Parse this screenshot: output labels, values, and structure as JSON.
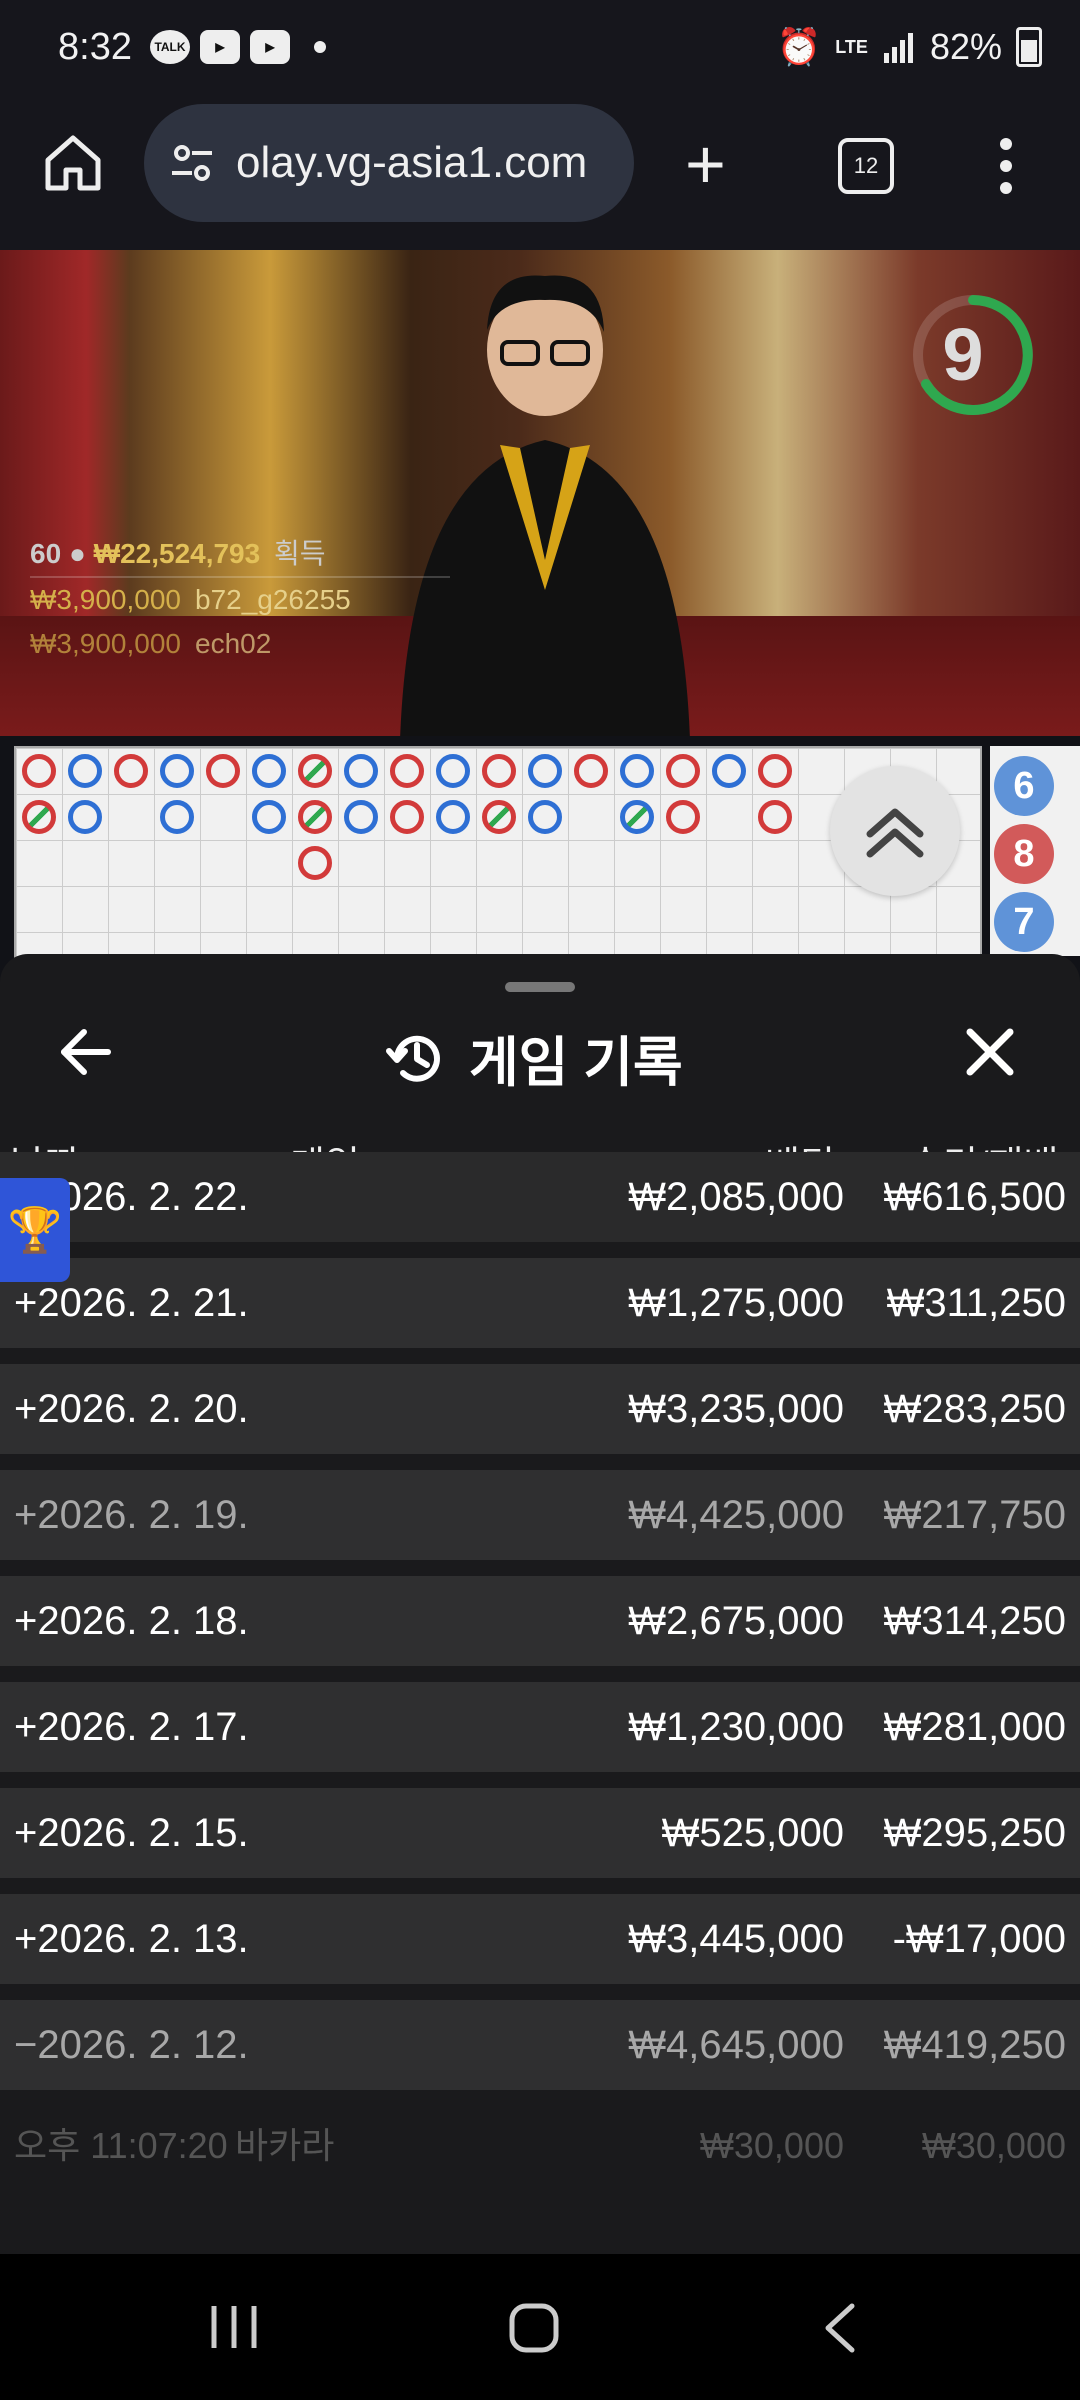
{
  "status": {
    "time": "8:32",
    "network": "LTE",
    "battery": "82%",
    "icons": [
      "talk-icon",
      "youtube-icon",
      "youtube-icon",
      "alarm-icon",
      "signal-icon",
      "battery-icon"
    ]
  },
  "browser": {
    "url": "play.vg-asia1.com",
    "url_display": "olay.vg-asia1.com",
    "tab_count": "12"
  },
  "video": {
    "countdown": "9",
    "winners": {
      "count": "60",
      "total": "₩22,524,793",
      "label": "획득",
      "rows": [
        {
          "amount": "₩3,900,000",
          "name": "b72_g26255"
        },
        {
          "amount": "₩3,900,000",
          "name": "ech02"
        }
      ]
    }
  },
  "road": {
    "side_numbers": [
      "6",
      "8",
      "7"
    ]
  },
  "panel": {
    "title": "게임 기록",
    "columns": {
      "date": "날짜",
      "game": "게임",
      "bet": "베팅",
      "result": "승리/패배"
    },
    "rows": [
      {
        "date": "+2026. 2. 22.",
        "bet": "₩2,085,000",
        "result": "₩616,500"
      },
      {
        "date": "+2026. 2. 21.",
        "bet": "₩1,275,000",
        "result": "₩311,250"
      },
      {
        "date": "+2026. 2. 20.",
        "bet": "₩3,235,000",
        "result": "₩283,250"
      },
      {
        "date": "+2026. 2. 19.",
        "bet": "₩4,425,000",
        "result": "₩217,750"
      },
      {
        "date": "+2026. 2. 18.",
        "bet": "₩2,675,000",
        "result": "₩314,250"
      },
      {
        "date": "+2026. 2. 17.",
        "bet": "₩1,230,000",
        "result": "₩281,000"
      },
      {
        "date": "+2026. 2. 15.",
        "bet": "₩525,000",
        "result": "₩295,250"
      },
      {
        "date": "+2026. 2. 13.",
        "bet": "₩3,445,000",
        "result": "-₩17,000"
      },
      {
        "date": "−2026. 2. 12.",
        "bet": "₩4,645,000",
        "result": "₩419,250"
      }
    ],
    "partial_row": {
      "time": "오후 11:07:20",
      "game": "바카라",
      "bet": "₩30,000",
      "result": "₩30,000"
    }
  },
  "colors": {
    "banker_red": "#d23a3a",
    "player_blue": "#2e6fd4",
    "tie_green": "#2fa84f",
    "gold": "#e3c15a"
  }
}
